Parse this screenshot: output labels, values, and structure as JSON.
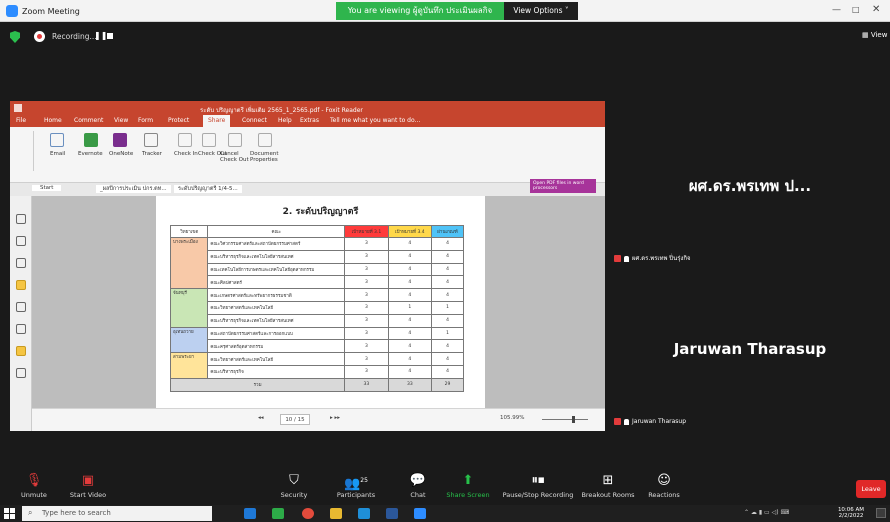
{
  "window": {
    "title": "Zoom Meeting",
    "share_banner": "You are viewing ผู้ดูบันทึก ประเมินผลกิจ screen",
    "view_options": "View Options ˅",
    "minimize": "—",
    "maximize": "□",
    "close": "✕"
  },
  "recording": {
    "label": "Recording...",
    "pause": "❚❚",
    "view": "▦ View"
  },
  "ppt": {
    "title": "ระดับ ปริญญาตรี เพิ่มเติม 2565_1_2565.pdf - Foxit Reader",
    "menu": [
      "File",
      "Home",
      "Comment",
      "View",
      "Form",
      "Protect",
      "Share",
      "Connect",
      "Help",
      "Extras",
      "Tell me what you want to do..."
    ],
    "tabs": [
      "Start",
      "_ผลปีการประเมิน ปกร.ตท...",
      "ระดับปริญญาตรี 1/4-5..."
    ],
    "ribbon_groups": [
      "Email",
      "Evernote",
      "OneNote",
      "Tracker",
      "Check In",
      "Check Out",
      "Cancel Check Out",
      "Document Properties"
    ],
    "open_pdf_promo": "Open PDF files in word processors",
    "slide_title": "2. ระดับปริญญาตรี",
    "table": {
      "headers": [
        "วิทยาเขต",
        "คณะ",
        "เป้าหมายที่ 3.1",
        "เป้าหมายที่ 3.4",
        "ผ่านเกณฑ์"
      ],
      "groups": [
        {
          "campus": "บางพระเมือง",
          "rows": [
            {
              "faculty": "คณะวิศวกรรมศาสตร์และสถาปัตยกรรมศาสตร์",
              "v1": "3",
              "v2": "4",
              "v3": "4"
            },
            {
              "faculty": "คณะบริหารธุรกิจและเทคโนโลยีสารสนเทศ",
              "v1": "3",
              "v2": "4",
              "v3": "4"
            },
            {
              "faculty": "คณะเทคโนโลยีการเกษตรและเทคโนโลยีอุตสาหกรรม",
              "v1": "3",
              "v2": "4",
              "v3": "4"
            },
            {
              "faculty": "คณะศิลปศาสตร์",
              "v1": "3",
              "v2": "4",
              "v3": "4"
            }
          ]
        },
        {
          "campus": "จันทบุรี",
          "rows": [
            {
              "faculty": "คณะเกษตรศาสตร์และทรัพยากรธรรมชาติ",
              "v1": "3",
              "v2": "4",
              "v3": "4"
            },
            {
              "faculty": "คณะวิทยาศาสตร์และเทคโนโลยี",
              "v1": "3",
              "v2": "1",
              "v3": "1"
            },
            {
              "faculty": "คณะบริหารธุรกิจและเทคโนโลยีสารสนเทศ",
              "v1": "3",
              "v2": "4",
              "v3": "4"
            }
          ]
        },
        {
          "campus": "อุเทนถวาย",
          "rows": [
            {
              "faculty": "คณะสถาปัตยกรรมศาสตร์และการออกแบบ",
              "v1": "3",
              "v2": "4",
              "v3": "1"
            },
            {
              "faculty": "คณะครุศาสตร์อุตสาหกรรม",
              "v1": "3",
              "v2": "4",
              "v3": "4"
            }
          ]
        },
        {
          "campus": "สามพระยา",
          "rows": [
            {
              "faculty": "คณะวิทยาศาสตร์และเทคโนโลยี",
              "v1": "3",
              "v2": "4",
              "v3": "4"
            },
            {
              "faculty": "คณะบริหารธุรกิจ",
              "v1": "3",
              "v2": "4",
              "v3": "4"
            }
          ]
        }
      ],
      "total": {
        "label": "รวม",
        "v1": "33",
        "v2": "33",
        "v3": "29"
      }
    },
    "status": {
      "page": "10 / 15",
      "zoom": "105.99%"
    }
  },
  "participants": [
    {
      "display_name": "ผศ.ดร.พรเทพ ป...",
      "label": "ผศ.ดร.พรเทพ ปิ่นรุ่งกิจ"
    },
    {
      "display_name": "Jaruwan Tharasup",
      "label": "Jaruwan Tharasup"
    }
  ],
  "toolbar": {
    "unmute": "Unmute",
    "start_video": "Start Video",
    "security": "Security",
    "participants": "Participants",
    "participants_count": "25",
    "chat": "Chat",
    "share_screen": "Share Screen",
    "pause_recording": "Pause/Stop Recording",
    "breakout": "Breakout Rooms",
    "reactions": "Reactions",
    "leave": "Leave"
  },
  "taskbar": {
    "search_placeholder": "Type here to search",
    "time": "10:06 AM",
    "date": "2/2/2022"
  },
  "colors": {
    "share_green": "#2fb54d",
    "ppt_red": "#c6452e",
    "leave_red": "#e02828",
    "header_red": "#ff3b3b",
    "header_yellow": "#ffd84a",
    "header_blue": "#4fc3f7",
    "campus_orange": "#f8c9a8",
    "campus_green": "#c9e6b5",
    "campus_blue": "#bcd0f0",
    "campus_yellow": "#ffe49a"
  }
}
